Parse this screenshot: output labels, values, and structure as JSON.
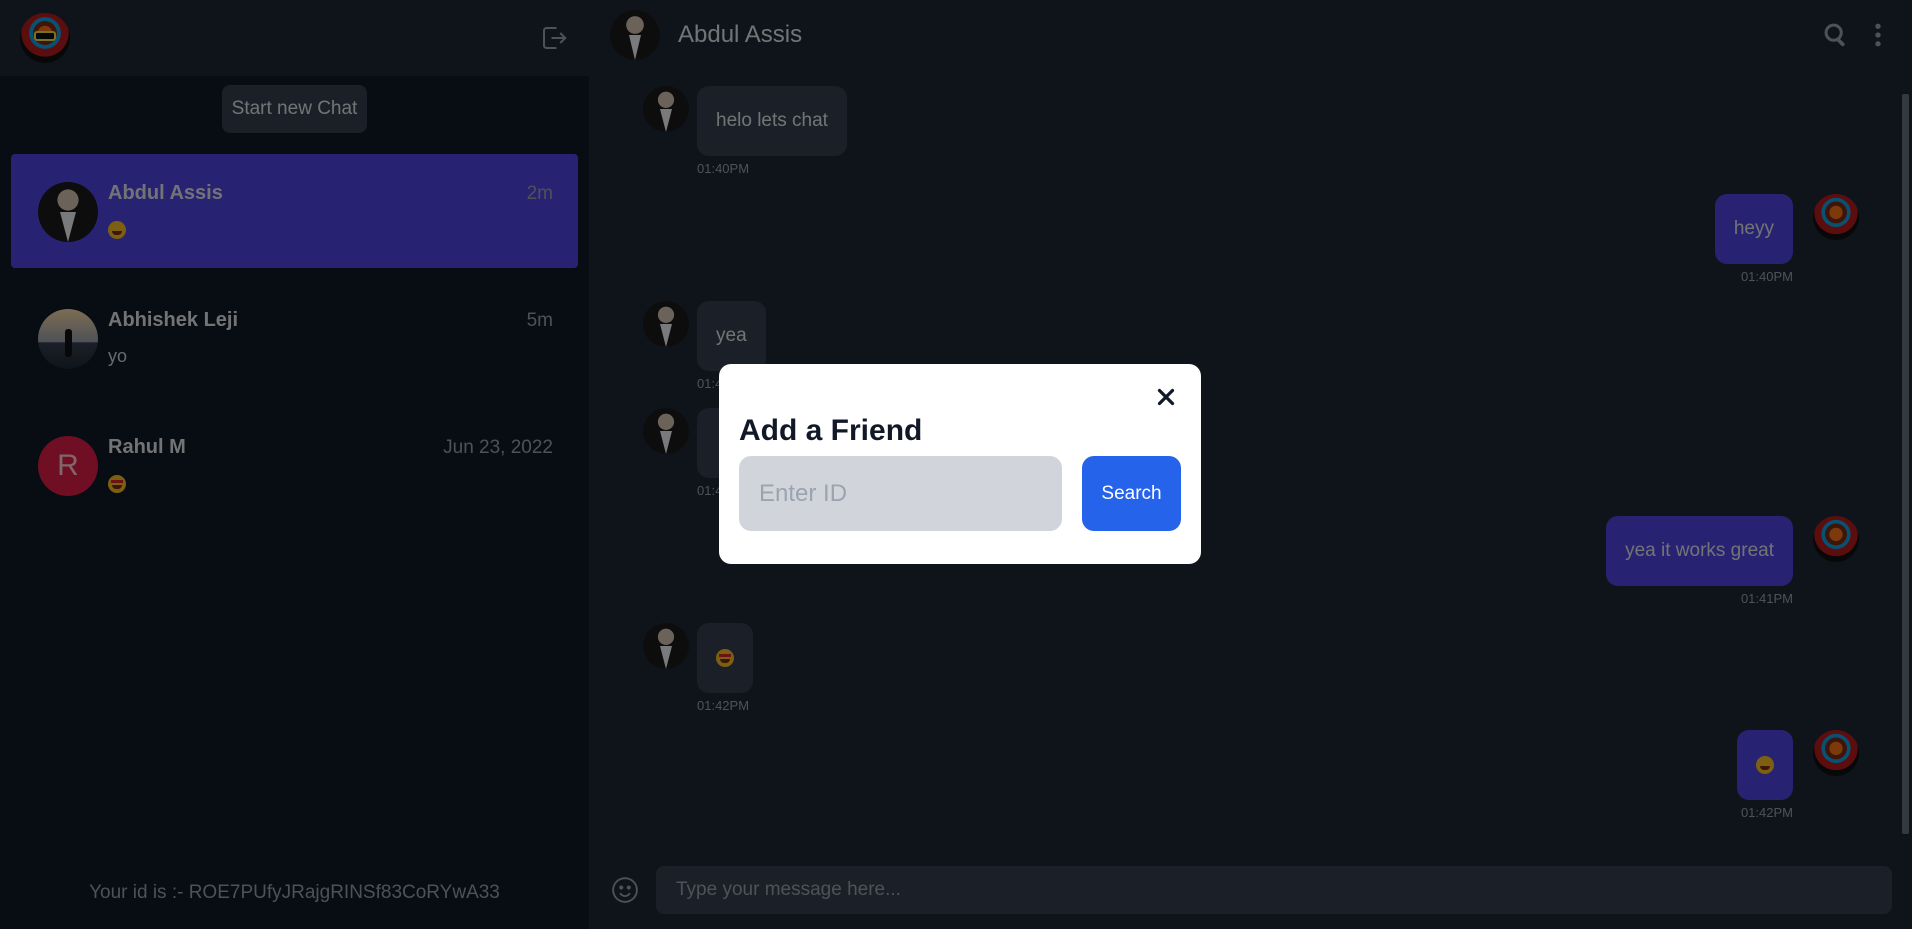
{
  "sidebar": {
    "new_chat_label": "Start new Chat",
    "user_id_text": "Your id is :- ROE7PUfyJRajgRINSf83CoRYwA33",
    "chats": [
      {
        "name": "Abdul Assis",
        "time": "2m",
        "preview_icon": "grin-emoji",
        "active": true
      },
      {
        "name": "Abhishek Leji",
        "time": "5m",
        "preview": "yo",
        "active": false
      },
      {
        "name": "Rahul M",
        "time": "Jun 23, 2022",
        "avatar_letter": "R",
        "preview_icon": "star-struck-emoji",
        "active": false
      }
    ]
  },
  "chat": {
    "contact_name": "Abdul Assis",
    "messages": [
      {
        "direction": "in",
        "text": "helo lets chat",
        "time": "01:40PM"
      },
      {
        "direction": "out",
        "text": "heyy",
        "time": "01:40PM"
      },
      {
        "direction": "in",
        "text": "yea",
        "time": "01:4"
      },
      {
        "direction": "in",
        "text": "",
        "time": "01:4"
      },
      {
        "direction": "out",
        "text": "yea it works great",
        "time": "01:41PM"
      },
      {
        "direction": "in",
        "icon": "star-struck-emoji",
        "time": "01:42PM"
      },
      {
        "direction": "out",
        "icon": "grin-emoji",
        "time": "01:42PM"
      }
    ],
    "composer_placeholder": "Type your message here..."
  },
  "modal": {
    "title": "Add a Friend",
    "input_placeholder": "Enter ID",
    "input_value": "",
    "search_label": "Search"
  },
  "colors": {
    "active_chat": "#4f46e5",
    "outgoing_bubble": "#4f46e5",
    "search_button": "#2563eb"
  }
}
